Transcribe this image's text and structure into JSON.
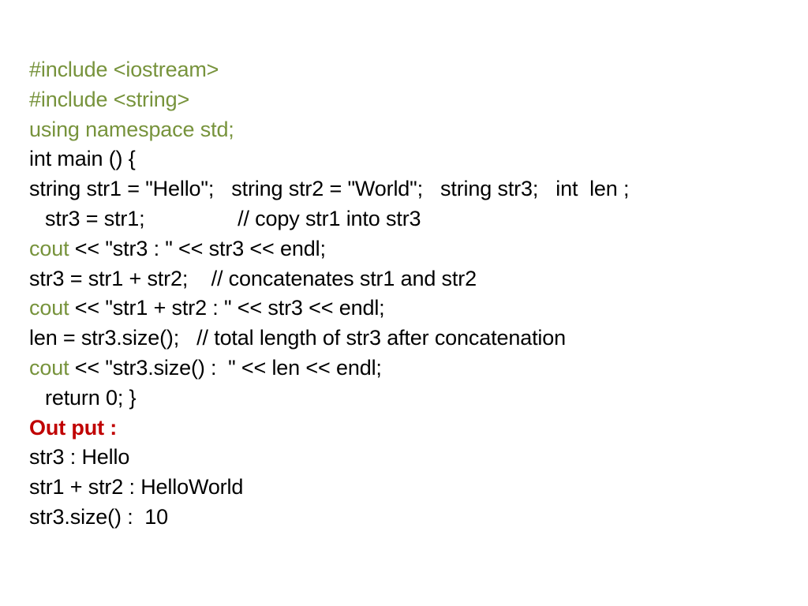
{
  "slide": {
    "background_color": "#FFFFFF",
    "accent_green": "#77933C",
    "accent_red": "#C00000",
    "body_color": "#000000"
  },
  "code": {
    "lines": [
      {
        "id": "include-iostream",
        "indent": false,
        "segments": [
          {
            "style": "green",
            "text": "#include <iostream>"
          }
        ]
      },
      {
        "id": "include-string",
        "indent": false,
        "segments": [
          {
            "style": "green",
            "text": "#include <string>"
          }
        ]
      },
      {
        "id": "using-namespace",
        "indent": false,
        "segments": [
          {
            "style": "green",
            "text": "using namespace std;"
          }
        ]
      },
      {
        "id": "int-main",
        "indent": false,
        "segments": [
          {
            "style": "black",
            "text": "int main () {"
          }
        ]
      },
      {
        "id": "declarations",
        "indent": false,
        "segments": [
          {
            "style": "black",
            "text": "string str1 = \"Hello\";   string str2 = \"World\";   string str3;   int  len ;"
          }
        ]
      },
      {
        "id": "copy-assign",
        "indent": true,
        "segments": [
          {
            "style": "black",
            "text": "str3 = str1;                // copy str1 into str3"
          }
        ]
      },
      {
        "id": "cout-str3",
        "indent": false,
        "segments": [
          {
            "style": "green",
            "text": "cout"
          },
          {
            "style": "black",
            "text": " << \"str3 : \" << str3 << endl;"
          }
        ]
      },
      {
        "id": "concat-assign",
        "indent": false,
        "segments": [
          {
            "style": "black",
            "text": "str3 = str1 + str2;    // concatenates str1 and str2"
          }
        ]
      },
      {
        "id": "cout-concat",
        "indent": false,
        "segments": [
          {
            "style": "green",
            "text": "cout"
          },
          {
            "style": "black",
            "text": " << \"str1 + str2 : \" << str3 << endl;"
          }
        ]
      },
      {
        "id": "len-assign",
        "indent": false,
        "segments": [
          {
            "style": "black",
            "text": "len = str3.size();   // total length of str3 after concatenation"
          }
        ]
      },
      {
        "id": "cout-size",
        "indent": false,
        "segments": [
          {
            "style": "green",
            "text": "cout"
          },
          {
            "style": "black",
            "text": " << \"str3.size() :  \" << len << endl;"
          }
        ]
      },
      {
        "id": "return-close",
        "indent": true,
        "segments": [
          {
            "style": "black",
            "text": "return 0; }"
          }
        ]
      }
    ]
  },
  "output": {
    "heading": "Out put :",
    "lines": [
      "str3 : Hello",
      "str1 + str2 : HelloWorld",
      "str3.size() :  10"
    ]
  }
}
